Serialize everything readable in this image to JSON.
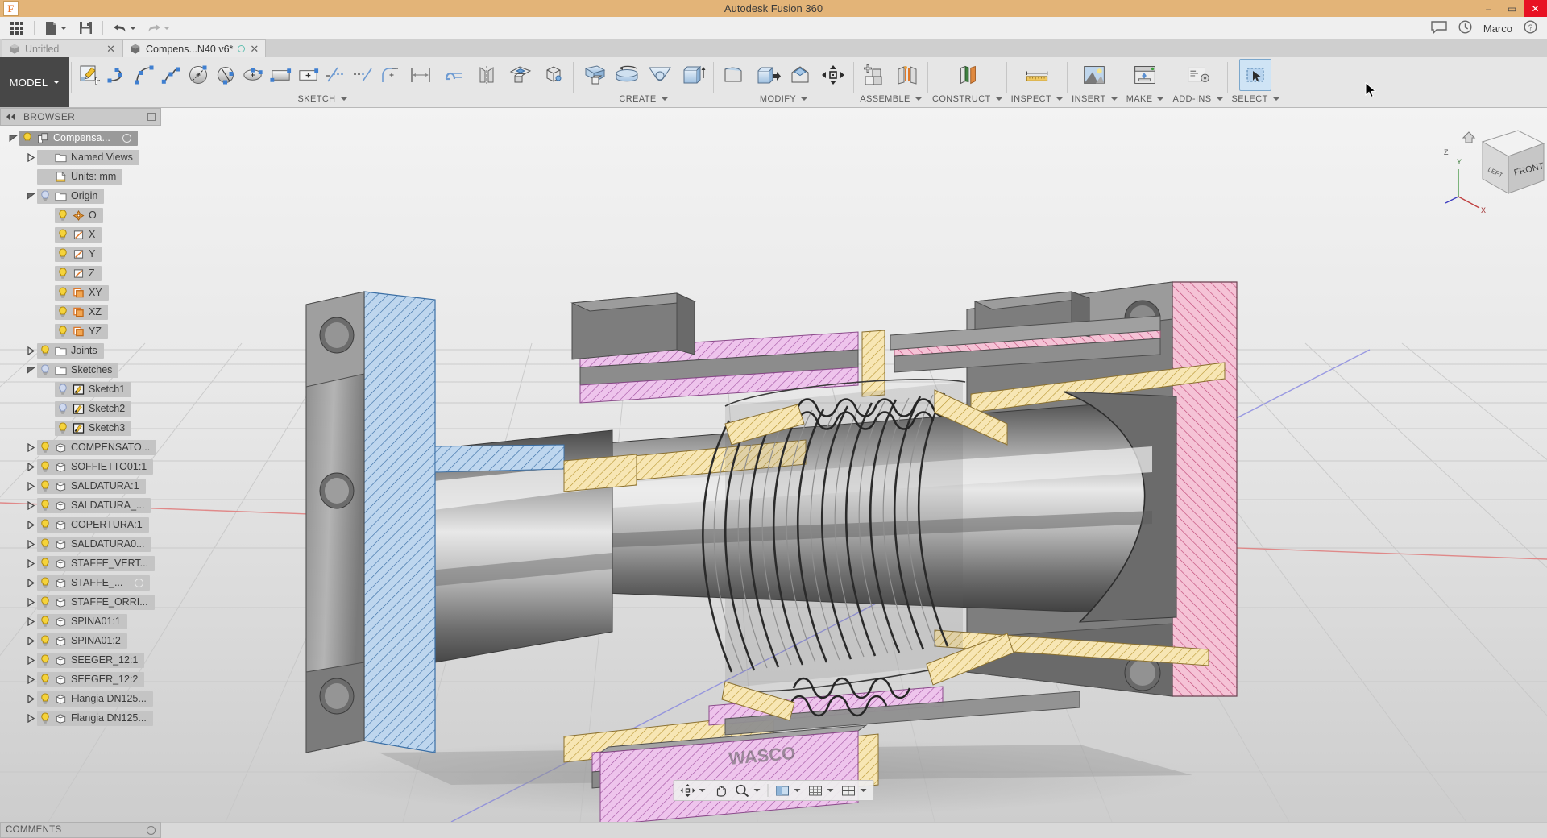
{
  "window": {
    "title": "Autodesk Fusion 360",
    "logo_text": "F",
    "minimize": "–",
    "maximize": "▭",
    "close": "✕"
  },
  "quick_access": {
    "app_grid": "app-grid",
    "new_file": "New",
    "save": "Save",
    "undo": "Undo",
    "redo": "Redo",
    "user_name": "Marco",
    "help": "?",
    "comments_icon": "comment-icon",
    "history_icon": "clock-icon"
  },
  "tabs": [
    {
      "label": "Untitled",
      "active": false,
      "close": "✕",
      "modified": false
    },
    {
      "label": "Compens...N40 v6*",
      "active": true,
      "close": "✕",
      "modified": true
    }
  ],
  "ribbon": {
    "workspace": "MODEL",
    "groups": [
      {
        "title": "SKETCH",
        "tools": [
          "create-sketch-icon",
          "line-icon",
          "arc-icon",
          "spline-icon",
          "circle-icon",
          "polygon-icon",
          "ellipse-icon",
          "rectangle-icon",
          "slot-icon",
          "offset-icon",
          "trim-icon",
          "fillet-icon",
          "dimension-icon",
          "text-icon",
          "mirror-icon",
          "project-icon",
          "construct-point-icon"
        ]
      },
      {
        "title": "CREATE",
        "tools": [
          "extrude-icon",
          "revolve-icon",
          "loft-icon",
          "sweep-icon"
        ]
      },
      {
        "title": "MODIFY",
        "tools": [
          "press-pull-icon",
          "fillet-3d-icon",
          "shell-icon",
          "move-copy-icon"
        ]
      },
      {
        "title": "ASSEMBLE",
        "tools": [
          "new-component-icon",
          "joint-icon"
        ]
      },
      {
        "title": "CONSTRUCT",
        "tools": [
          "offset-plane-icon"
        ]
      },
      {
        "title": "INSPECT",
        "tools": [
          "measure-icon"
        ]
      },
      {
        "title": "INSERT",
        "tools": [
          "insert-image-icon"
        ]
      },
      {
        "title": "MAKE",
        "tools": [
          "3d-print-icon"
        ]
      },
      {
        "title": "ADD-INS",
        "tools": [
          "scripts-addins-icon"
        ]
      },
      {
        "title": "SELECT",
        "tools": [
          "select-icon"
        ]
      }
    ]
  },
  "browser": {
    "header": "BROWSER",
    "collapse_icon": "collapse-left-icon",
    "items": [
      {
        "label": "Compensa...",
        "indent": 0,
        "toggle": "expanded",
        "icon": "component-icon",
        "bulb": "on",
        "selected": true,
        "dot": true
      },
      {
        "label": "Named Views",
        "indent": 1,
        "toggle": "collapsed",
        "icon": "folder-icon",
        "bulb": "none"
      },
      {
        "label": "Units: mm",
        "indent": 1,
        "toggle": "none",
        "icon": "document-icon",
        "bulb": "none"
      },
      {
        "label": "Origin",
        "indent": 1,
        "toggle": "expanded",
        "icon": "folder-icon",
        "bulb": "off"
      },
      {
        "label": "O",
        "indent": 2,
        "toggle": "none",
        "icon": "origin-point-icon",
        "bulb": "on"
      },
      {
        "label": "X",
        "indent": 2,
        "toggle": "none",
        "icon": "axis-icon",
        "bulb": "on"
      },
      {
        "label": "Y",
        "indent": 2,
        "toggle": "none",
        "icon": "axis-icon",
        "bulb": "on"
      },
      {
        "label": "Z",
        "indent": 2,
        "toggle": "none",
        "icon": "axis-icon",
        "bulb": "on"
      },
      {
        "label": "XY",
        "indent": 2,
        "toggle": "none",
        "icon": "plane-icon",
        "bulb": "on"
      },
      {
        "label": "XZ",
        "indent": 2,
        "toggle": "none",
        "icon": "plane-icon",
        "bulb": "on"
      },
      {
        "label": "YZ",
        "indent": 2,
        "toggle": "none",
        "icon": "plane-icon",
        "bulb": "on"
      },
      {
        "label": "Joints",
        "indent": 1,
        "toggle": "collapsed",
        "icon": "folder-icon",
        "bulb": "on"
      },
      {
        "label": "Sketches",
        "indent": 1,
        "toggle": "expanded",
        "icon": "folder-icon",
        "bulb": "off"
      },
      {
        "label": "Sketch1",
        "indent": 2,
        "toggle": "none",
        "icon": "sketch-icon",
        "bulb": "off"
      },
      {
        "label": "Sketch2",
        "indent": 2,
        "toggle": "none",
        "icon": "sketch-icon",
        "bulb": "off"
      },
      {
        "label": "Sketch3",
        "indent": 2,
        "toggle": "none",
        "icon": "sketch-icon",
        "bulb": "on"
      },
      {
        "label": "COMPENSATO...",
        "indent": 1,
        "toggle": "collapsed",
        "icon": "body-icon",
        "bulb": "on"
      },
      {
        "label": "SOFFIETTO01:1",
        "indent": 1,
        "toggle": "collapsed",
        "icon": "body-icon",
        "bulb": "on"
      },
      {
        "label": "SALDATURA:1",
        "indent": 1,
        "toggle": "collapsed",
        "icon": "body-icon",
        "bulb": "on"
      },
      {
        "label": "SALDATURA_...",
        "indent": 1,
        "toggle": "collapsed",
        "icon": "body-icon",
        "bulb": "on"
      },
      {
        "label": "COPERTURA:1",
        "indent": 1,
        "toggle": "collapsed",
        "icon": "body-icon",
        "bulb": "on"
      },
      {
        "label": "SALDATURA0...",
        "indent": 1,
        "toggle": "collapsed",
        "icon": "body-icon",
        "bulb": "on"
      },
      {
        "label": "STAFFE_VERT...",
        "indent": 1,
        "toggle": "collapsed",
        "icon": "body-icon",
        "bulb": "on"
      },
      {
        "label": "STAFFE_...",
        "indent": 1,
        "toggle": "collapsed",
        "icon": "body-icon",
        "bulb": "on",
        "dot": true
      },
      {
        "label": "STAFFE_ORRI...",
        "indent": 1,
        "toggle": "collapsed",
        "icon": "body-icon",
        "bulb": "on"
      },
      {
        "label": "SPINA01:1",
        "indent": 1,
        "toggle": "collapsed",
        "icon": "body-icon",
        "bulb": "on"
      },
      {
        "label": "SPINA01:2",
        "indent": 1,
        "toggle": "collapsed",
        "icon": "body-icon",
        "bulb": "on"
      },
      {
        "label": "SEEGER_12:1",
        "indent": 1,
        "toggle": "collapsed",
        "icon": "body-icon",
        "bulb": "on"
      },
      {
        "label": "SEEGER_12:2",
        "indent": 1,
        "toggle": "collapsed",
        "icon": "body-icon",
        "bulb": "on"
      },
      {
        "label": "Flangia DN125...",
        "indent": 1,
        "toggle": "collapsed",
        "icon": "body-icon",
        "bulb": "on"
      },
      {
        "label": "Flangia DN125...",
        "indent": 1,
        "toggle": "collapsed",
        "icon": "body-icon",
        "bulb": "on"
      }
    ]
  },
  "comments": {
    "label": "COMMENTS",
    "expand_icon": "expand-icon"
  },
  "navbar": {
    "buttons": [
      "orbit-icon",
      "pan-icon",
      "zoom-icon",
      "display-settings-icon",
      "grid-snap-icon",
      "viewports-icon"
    ]
  },
  "viewcube": {
    "front_label": "FRONT",
    "left_label": "LEFT",
    "axis_z": "Z",
    "axis_y": "Y",
    "axis_x": "X",
    "home_icon": "home-icon"
  },
  "colors": {
    "title_bar": "#e3b478",
    "close_button": "#e81123",
    "workspace_button": "#474747",
    "selection": "#cfe4f5",
    "section_blue": "#a9c9e8",
    "section_pink": "#f0b8cf",
    "section_yellow": "#f5e0a8",
    "section_magenta": "#e7b8e7",
    "axis_x": "#e05a5a",
    "axis_y": "#5ac45a",
    "axis_z": "#5a5ae0"
  },
  "model": {
    "watermark": "WASCO"
  }
}
